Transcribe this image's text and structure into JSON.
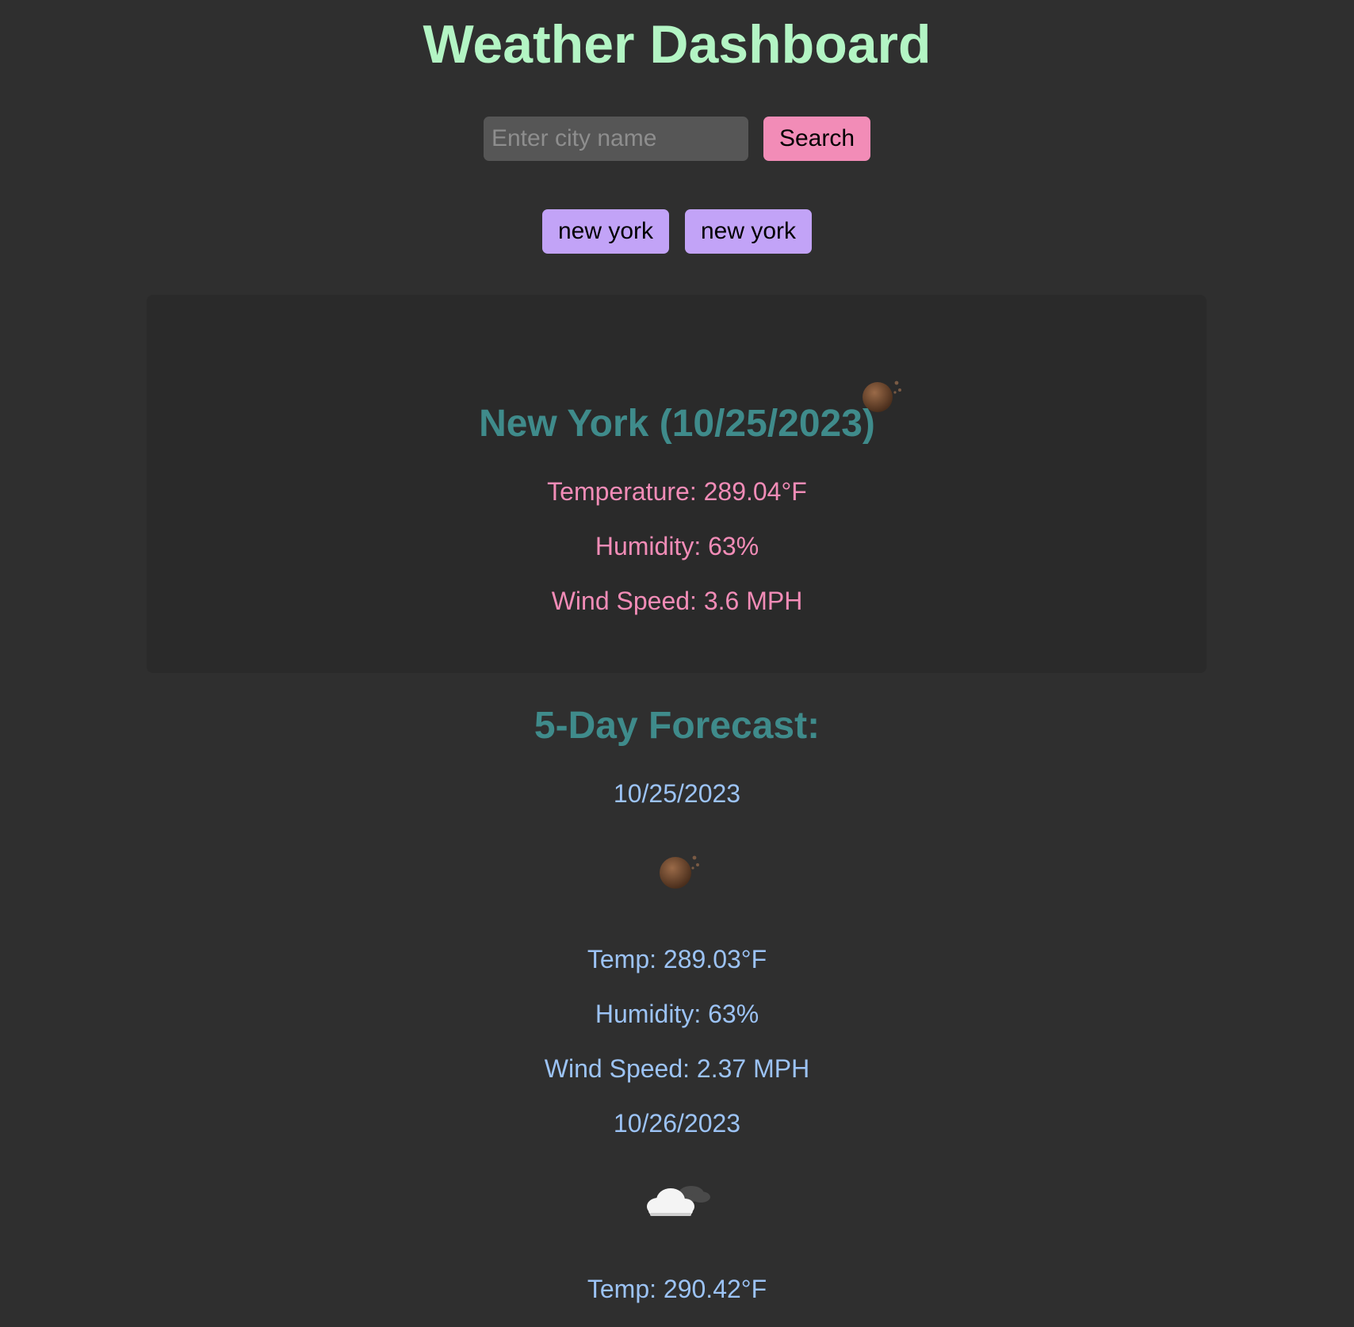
{
  "app": {
    "title": "Weather Dashboard"
  },
  "search": {
    "placeholder": "Enter city name",
    "value": "",
    "button_label": "Search"
  },
  "history": [
    {
      "label": "new york"
    },
    {
      "label": "new york"
    }
  ],
  "current": {
    "heading": "New York (10/25/2023)",
    "icon": "night-moon-icon",
    "temperature": "Temperature: 289.04°F",
    "humidity": "Humidity: 63%",
    "wind": "Wind Speed: 3.6 MPH"
  },
  "forecast": {
    "heading": "5-Day Forecast:",
    "days": [
      {
        "date": "10/25/2023",
        "icon": "night-moon-icon",
        "temp": "Temp: 289.03°F",
        "humidity": "Humidity: 63%",
        "wind": "Wind Speed: 2.37 MPH"
      },
      {
        "date": "10/26/2023",
        "icon": "night-cloudy-icon",
        "temp": "Temp: 290.42°F"
      }
    ]
  },
  "colors": {
    "background": "#2f2f2f",
    "panel": "#2a2a2a",
    "title": "#b3f5c4",
    "heading": "#3f8b8b",
    "current_text": "#f28cb7",
    "forecast_text": "#9cc3f5",
    "search_button": "#f28cb7",
    "history_button": "#c2a3f7"
  }
}
